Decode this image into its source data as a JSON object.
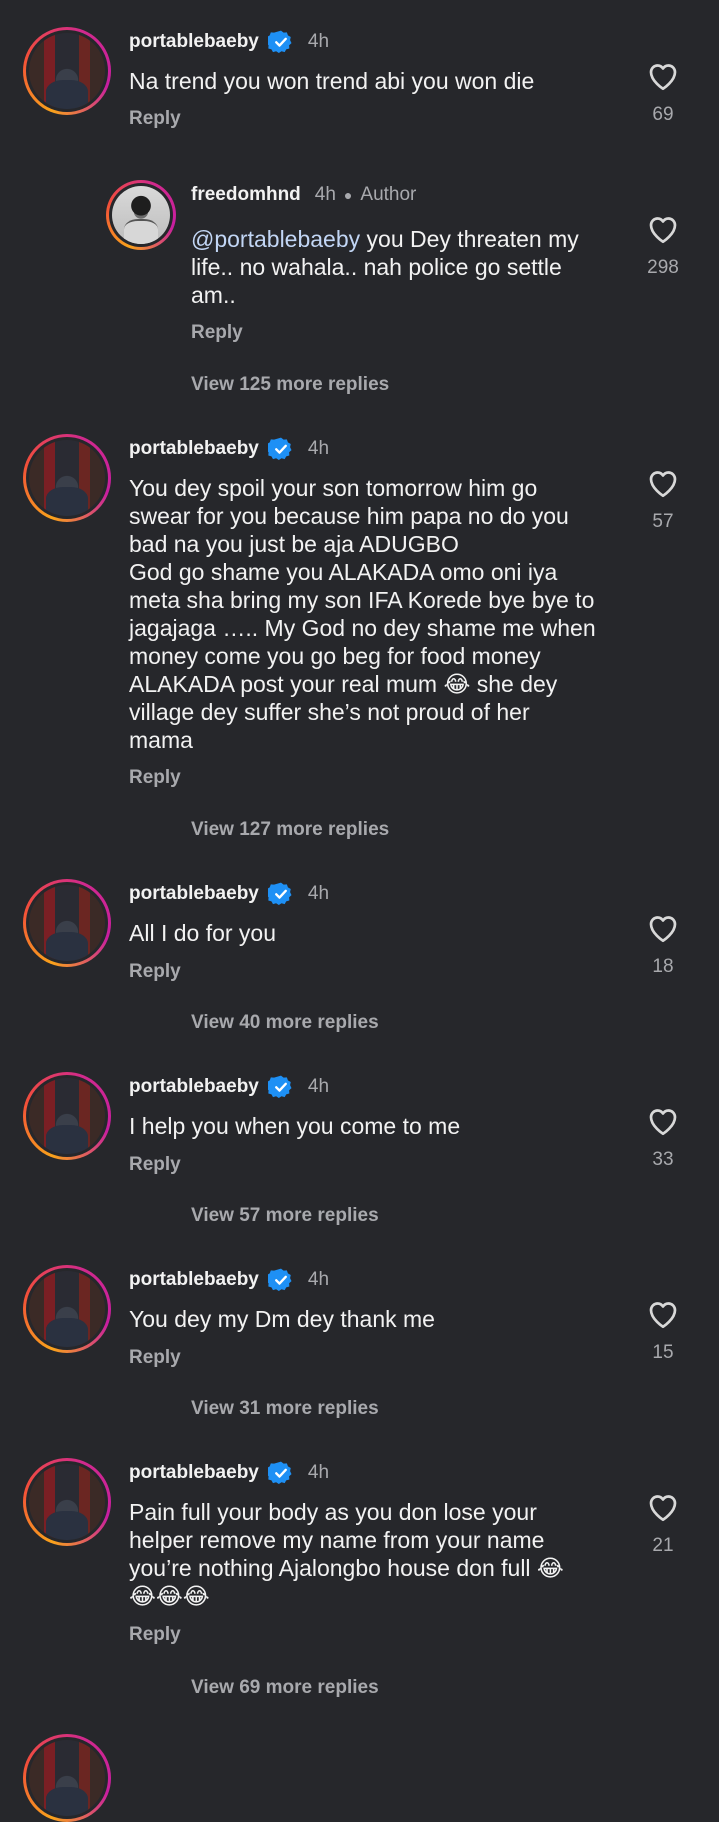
{
  "colors": {
    "background": "#26272b",
    "text": "#f2f2f2",
    "muted": "#a8a9ad",
    "mention": "#c2d6f5",
    "verified": "#1e90f5"
  },
  "icons": {
    "verified": "verified-badge-icon",
    "like": "heart-outline-icon"
  },
  "comments": [
    {
      "username": "portablebaeby",
      "time": "4h",
      "text": "Na trend you won trend abi you won die",
      "reply_label": "Reply",
      "likes": "69"
    },
    {
      "username": "freedomhnd",
      "time": "4h",
      "author_label": "Author",
      "mention": "@portablebaeby",
      "text": " you Dey threaten my\nlife.. no wahala.. nah police go settle\nam..",
      "reply_label": "Reply",
      "likes": "298",
      "more_replies": "View 125 more replies"
    },
    {
      "username": "portablebaeby",
      "time": "4h",
      "text": "You dey spoil your son tomorrow him go\nswear for you because him papa no do you\nbad na you just be aja ADUGBO\nGod go shame you ALAKADA omo oni iya\nmeta sha bring my son IFA Korede bye bye to\njagajaga ….. My God no dey shame me when\nmoney come you go beg for food money\nALAKADA post your real mum 😂 she dey\nvillage dey suffer she’s not proud of her\nmama",
      "reply_label": "Reply",
      "likes": "57",
      "more_replies": "View 127 more replies"
    },
    {
      "username": "portablebaeby",
      "time": "4h",
      "text": "All I do for you",
      "reply_label": "Reply",
      "likes": "18",
      "more_replies": "View 40 more replies"
    },
    {
      "username": "portablebaeby",
      "time": "4h",
      "text": "I help you when you come to me",
      "reply_label": "Reply",
      "likes": "33",
      "more_replies": "View 57 more replies"
    },
    {
      "username": "portablebaeby",
      "time": "4h",
      "text": "You dey my Dm dey thank me",
      "reply_label": "Reply",
      "likes": "15",
      "more_replies": "View 31 more replies"
    },
    {
      "username": "portablebaeby",
      "time": "4h",
      "text": "Pain full your body as you don lose your\nhelper remove my name from your name\nyou’re nothing Ajalongbo house don full 😂\n😂😂😂",
      "reply_label": "Reply",
      "likes": "21",
      "more_replies": "View 69 more replies"
    }
  ]
}
